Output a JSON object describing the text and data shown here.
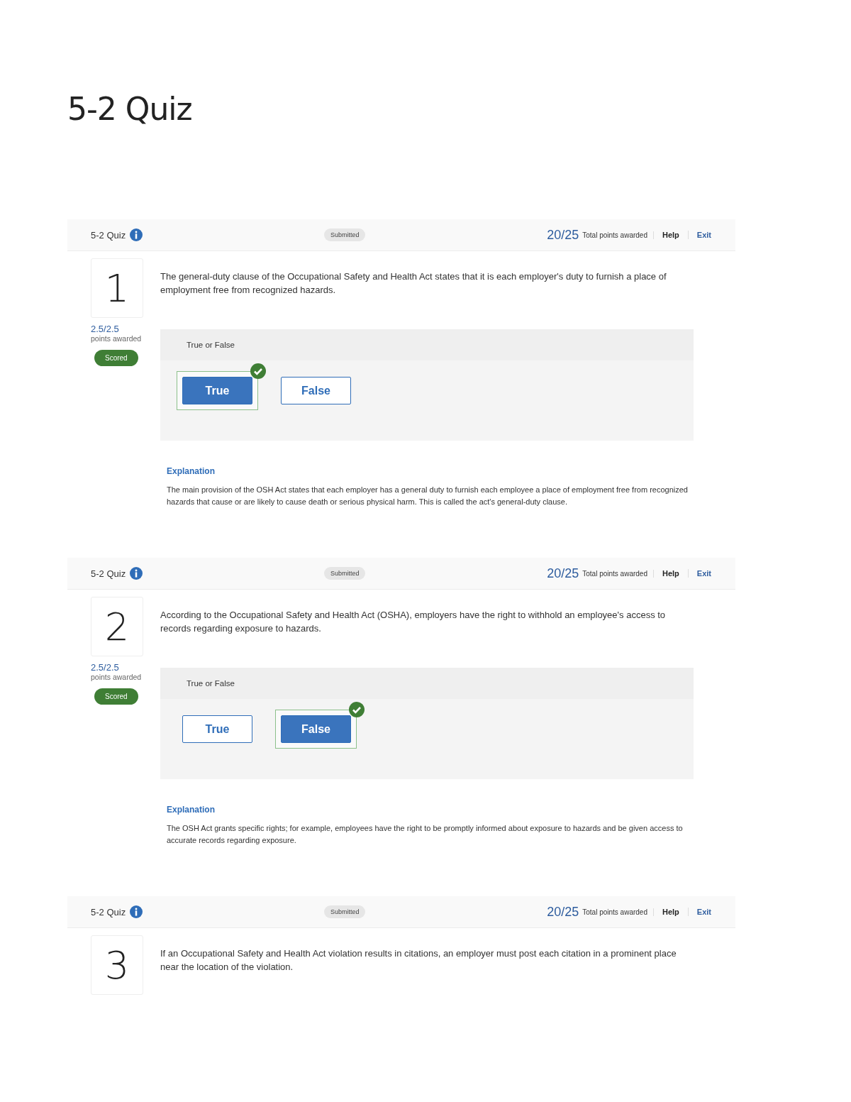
{
  "title": "5-2 Quiz",
  "sections": [
    {
      "header": {
        "quiz_name": "5-2 Quiz",
        "status": "Submitted",
        "score": "20/25",
        "score_label": "Total points awarded",
        "links": [
          "Help",
          "Exit"
        ]
      },
      "number": "1",
      "text": "The general-duty clause of the Occupational Safety and Health Act states that it is each employer's duty to furnish a place of employment free from recognized hazards.",
      "points": "2.5/2.5",
      "points_label": "points awarded",
      "badge": "Scored",
      "type_label": "True or False",
      "options": [
        {
          "label": "True",
          "selected": true
        },
        {
          "label": "False",
          "selected": false
        }
      ],
      "explanation_title": "Explanation",
      "explanation": "The main provision of the OSH Act states that each employer has a general duty to furnish each employee a place of employment free from recognized hazards that cause or are likely to cause death or serious physical harm. This is called the act's general-duty clause."
    },
    {
      "header": {
        "quiz_name": "5-2 Quiz",
        "status": "Submitted",
        "score": "20/25",
        "score_label": "Total points awarded",
        "links": [
          "Help",
          "Exit"
        ]
      },
      "number": "2",
      "text": "According to the Occupational Safety and Health Act (OSHA), employers have the right to withhold an employee's access to records regarding exposure to hazards.",
      "points": "2.5/2.5",
      "points_label": "points awarded",
      "badge": "Scored",
      "type_label": "True or False",
      "options": [
        {
          "label": "True",
          "selected": false
        },
        {
          "label": "False",
          "selected": true
        }
      ],
      "explanation_title": "Explanation",
      "explanation": "The OSH Act grants specific rights; for example, employees have the right to be promptly informed about exposure to hazards and be given access to accurate records regarding exposure."
    },
    {
      "header": {
        "quiz_name": "5-2 Quiz",
        "status": "Submitted",
        "score": "20/25",
        "score_label": "Total points awarded",
        "links": [
          "Help",
          "Exit"
        ]
      },
      "number": "3",
      "text": "If an Occupational Safety and Health Act violation results in citations, an employer must post each citation in a prominent place near the location of the violation."
    }
  ]
}
